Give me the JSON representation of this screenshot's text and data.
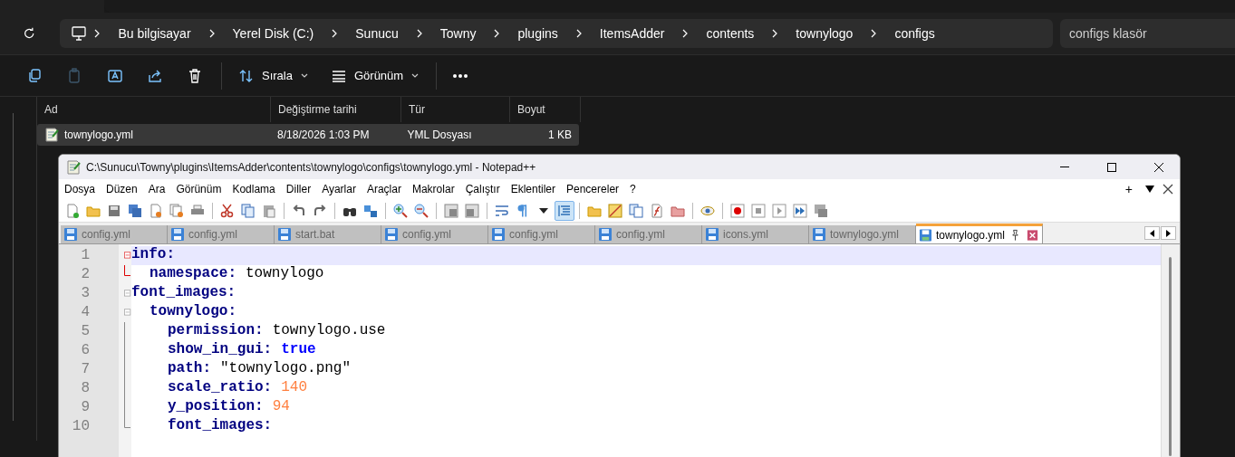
{
  "explorer": {
    "breadcrumbs": [
      "Bu bilgisayar",
      "Yerel Disk (C:)",
      "Sunucu",
      "Towny",
      "plugins",
      "ItemsAdder",
      "contents",
      "townylogo",
      "configs"
    ],
    "search": {
      "placeholder": "configs klasör"
    },
    "commands": [
      {
        "kind": "copy",
        "disabled": false
      },
      {
        "kind": "paste",
        "disabled": true
      },
      {
        "kind": "rename",
        "disabled": false
      },
      {
        "kind": "share",
        "disabled": false
      },
      {
        "kind": "delete",
        "disabled": false
      },
      {
        "kind": "sort",
        "label": "Sırala",
        "disabled": false
      },
      {
        "kind": "view",
        "label": "Görünüm",
        "disabled": false
      },
      {
        "kind": "more",
        "disabled": false
      }
    ],
    "columns": [
      "Ad",
      "Değiştirme tarihi",
      "Tür",
      "Boyut"
    ],
    "files": [
      {
        "name": "townylogo.yml",
        "modified": "8/18/2026 1:03 PM",
        "type": "YML Dosyası",
        "size": "1 KB",
        "selected": true
      }
    ]
  },
  "notepad": {
    "title": "C:\\Sunucu\\Towny\\plugins\\ItemsAdder\\contents\\townylogo\\configs\\townylogo.yml - Notepad++",
    "menu": [
      "Dosya",
      "Düzen",
      "Ara",
      "Görünüm",
      "Kodlama",
      "Diller",
      "Ayarlar",
      "Araçlar",
      "Makrolar",
      "Çalıştır",
      "Eklentiler",
      "Pencereler",
      "?"
    ],
    "menu_right": [
      "+"
    ],
    "tabs": [
      {
        "label": "config.yml",
        "selected": false
      },
      {
        "label": "config.yml",
        "selected": false
      },
      {
        "label": "start.bat",
        "selected": false
      },
      {
        "label": "config.yml",
        "selected": false
      },
      {
        "label": "config.yml",
        "selected": false
      },
      {
        "label": "config.yml",
        "selected": false
      },
      {
        "label": "icons.yml",
        "selected": false
      },
      {
        "label": "townylogo.yml",
        "selected": false
      },
      {
        "label": "townylogo.yml",
        "selected": true
      }
    ],
    "lines": [
      {
        "number": "1",
        "key": "info:",
        "current": true,
        "children": [
          {
            "number": "2",
            "key": "namespace:",
            "value": "townylogo",
            "current": false
          }
        ]
      },
      {
        "number": "3",
        "key": "font_images:",
        "current": false,
        "children": [
          {
            "number": "4",
            "key": "townylogo:",
            "current": false,
            "children": [
              {
                "number": "5",
                "key": "permission:",
                "value": "townylogo.use",
                "current": false
              },
              {
                "number": "6",
                "key": "show_in_gui:",
                "value": "true",
                "kind": "bool",
                "current": false
              },
              {
                "number": "7",
                "key": "path:",
                "value": "\"townylogo.png\"",
                "current": false
              },
              {
                "number": "8",
                "key": "scale_ratio:",
                "value": "140",
                "kind": "number",
                "current": false
              },
              {
                "number": "9",
                "key": "y_position:",
                "value": "94",
                "kind": "number",
                "current": false
              },
              {
                "number": "10",
                "key": "font_images:",
                "current": false
              }
            ]
          }
        ]
      }
    ]
  }
}
